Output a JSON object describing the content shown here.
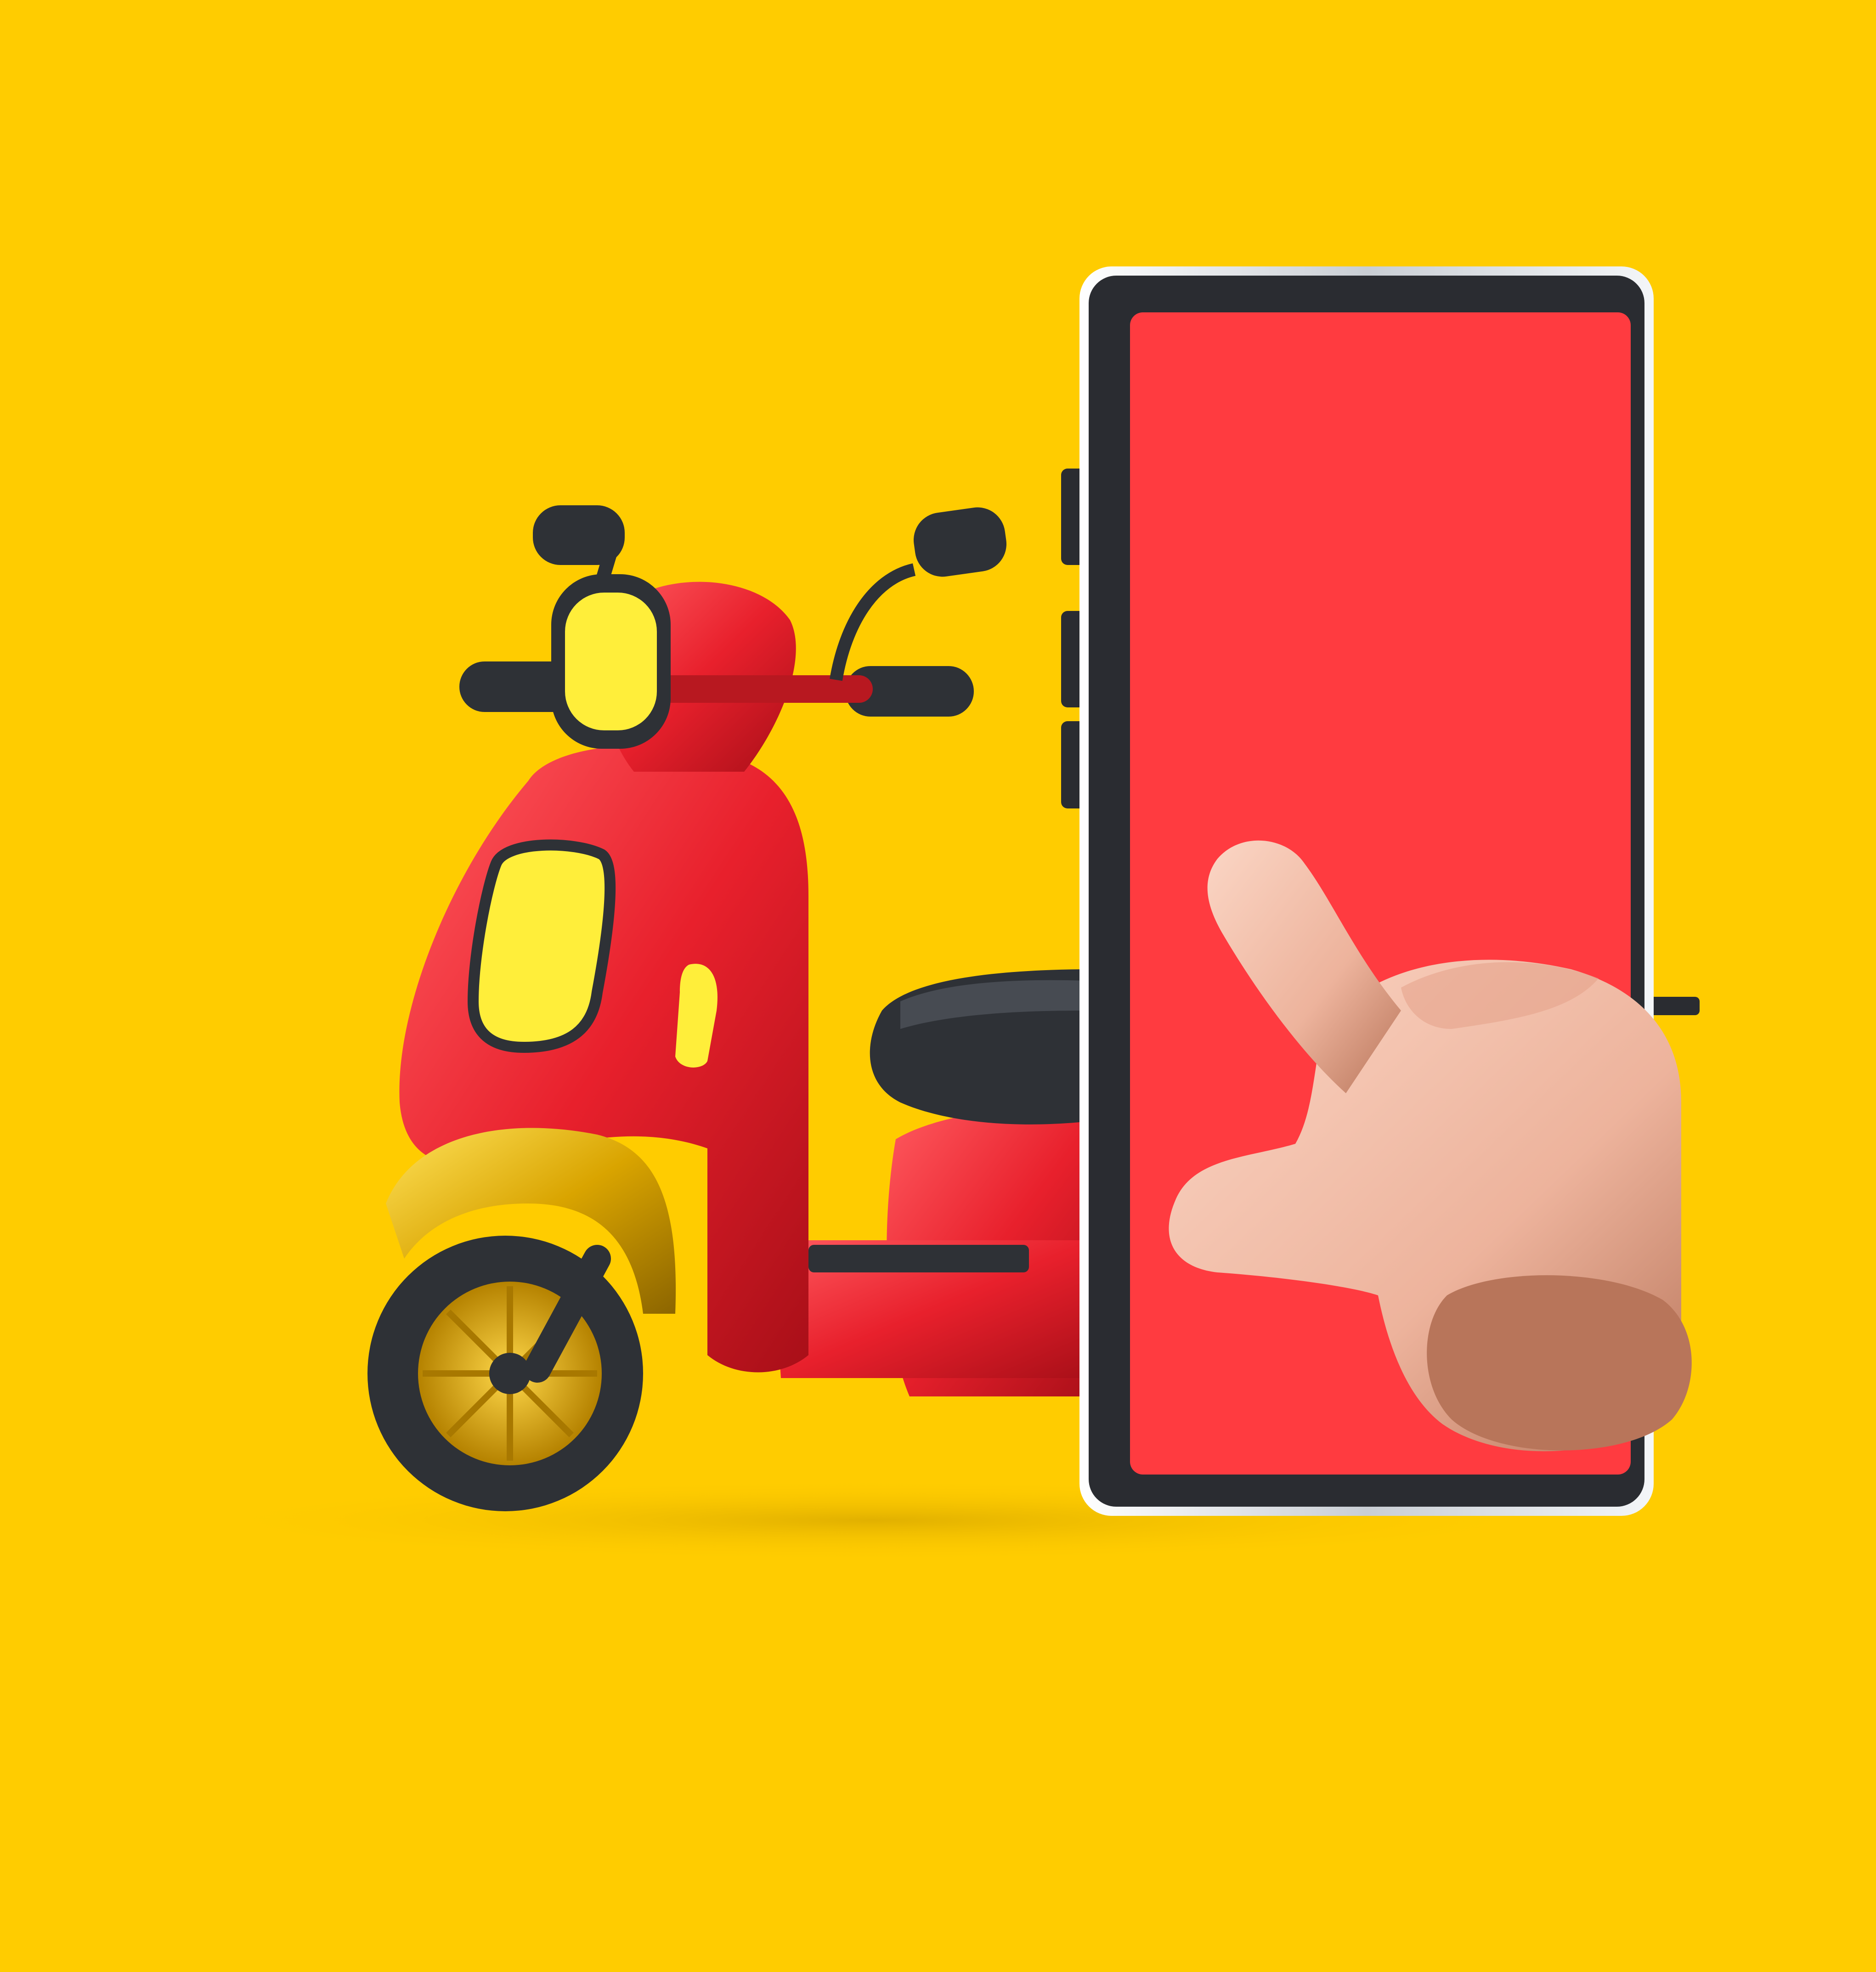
{
  "scene": {
    "description_colors": {
      "background": "#FFCC00",
      "scooter_body": "#E8202C",
      "scooter_trim_gold": "#D9A400",
      "scooter_dark": "#2E3136",
      "scooter_yellow_panel": "#FFEE3A",
      "phone_frame": "#2A2C31",
      "phone_bezel_silver": "#E9ECEF",
      "phone_screen": "#FF3B40",
      "hand_skin": "#F1BCA6"
    }
  }
}
